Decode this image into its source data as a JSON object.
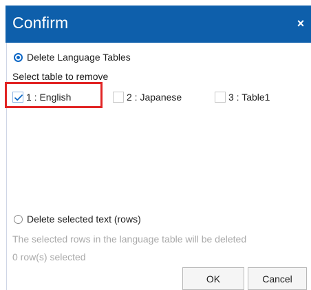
{
  "dialog": {
    "title": "Confirm",
    "close_label": "×"
  },
  "delete_tables": {
    "label": "Delete Language Tables",
    "selected": true
  },
  "select_table_label": "Select table to remove",
  "tables": [
    {
      "label": "1 : English",
      "checked": true
    },
    {
      "label": "2 : Japanese",
      "checked": false
    },
    {
      "label": "3 : Table1",
      "checked": false
    }
  ],
  "delete_rows": {
    "label": "Delete selected text (rows)",
    "selected": false,
    "description": "The selected rows in the language table will be deleted",
    "count_text": "0 row(s) selected"
  },
  "buttons": {
    "ok": "OK",
    "cancel": "Cancel"
  },
  "colors": {
    "titlebar": "#0e5fab",
    "accent": "#0b67c6",
    "highlight": "#e12424"
  }
}
